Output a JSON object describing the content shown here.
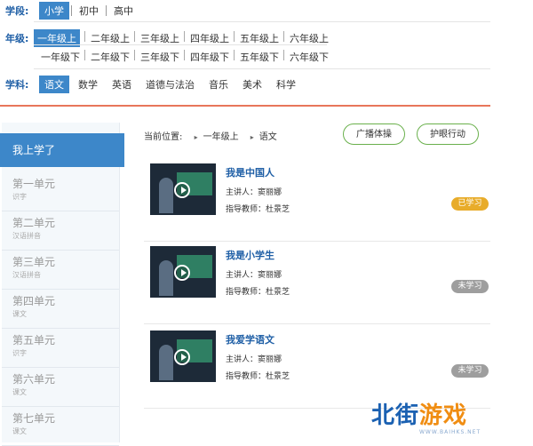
{
  "filters": {
    "stage": {
      "label": "学段:",
      "options": [
        "小学",
        "初中",
        "高中"
      ],
      "selected": "小学"
    },
    "grade": {
      "label": "年级:",
      "row1": [
        "一年级上",
        "二年级上",
        "三年级上",
        "四年级上",
        "五年级上",
        "六年级上"
      ],
      "row2": [
        "一年级下",
        "二年级下",
        "三年级下",
        "四年级下",
        "五年级下",
        "六年级下"
      ],
      "selected": "一年级上"
    },
    "subject": {
      "label": "学科:",
      "options": [
        "语文",
        "数学",
        "英语",
        "道德与法治",
        "音乐",
        "美术",
        "科学"
      ],
      "selected": "语文"
    }
  },
  "sidebar": {
    "header": "我上学了",
    "units": [
      {
        "title": "第一单元",
        "sub": "识字"
      },
      {
        "title": "第二单元",
        "sub": "汉语拼音"
      },
      {
        "title": "第三单元",
        "sub": "汉语拼音"
      },
      {
        "title": "第四单元",
        "sub": "课文"
      },
      {
        "title": "第五单元",
        "sub": "识字"
      },
      {
        "title": "第六单元",
        "sub": "课文"
      },
      {
        "title": "第七单元",
        "sub": "课文"
      }
    ]
  },
  "breadcrumb": {
    "label": "当前位置:",
    "items": [
      "一年级上",
      "语文"
    ]
  },
  "buttons": {
    "broadcast": "广播体操",
    "eye_care": "护眼行动"
  },
  "courses": [
    {
      "title": "我是中国人",
      "lecturer": "主讲人：窦丽娜",
      "mentor": "指导教师：杜景芝",
      "status": "已学习",
      "status_color": "#e8ac2a"
    },
    {
      "title": "我是小学生",
      "lecturer": "主讲人：窦丽娜",
      "mentor": "指导教师：杜景芝",
      "status": "未学习",
      "status_color": "#9e9e9e"
    },
    {
      "title": "我爱学语文",
      "lecturer": "主讲人：窦丽娜",
      "mentor": "指导教师：杜景芝",
      "status": "未学习",
      "status_color": "#9e9e9e"
    }
  ],
  "watermark": {
    "part1": "北街",
    "part2": "游戏",
    "sub": "WWW.BAIHKS.NET"
  },
  "colors": {
    "accent": "#3d87c9",
    "title": "#1f5fa6",
    "divider": "#e8765a",
    "button_border": "#6ab04c"
  }
}
